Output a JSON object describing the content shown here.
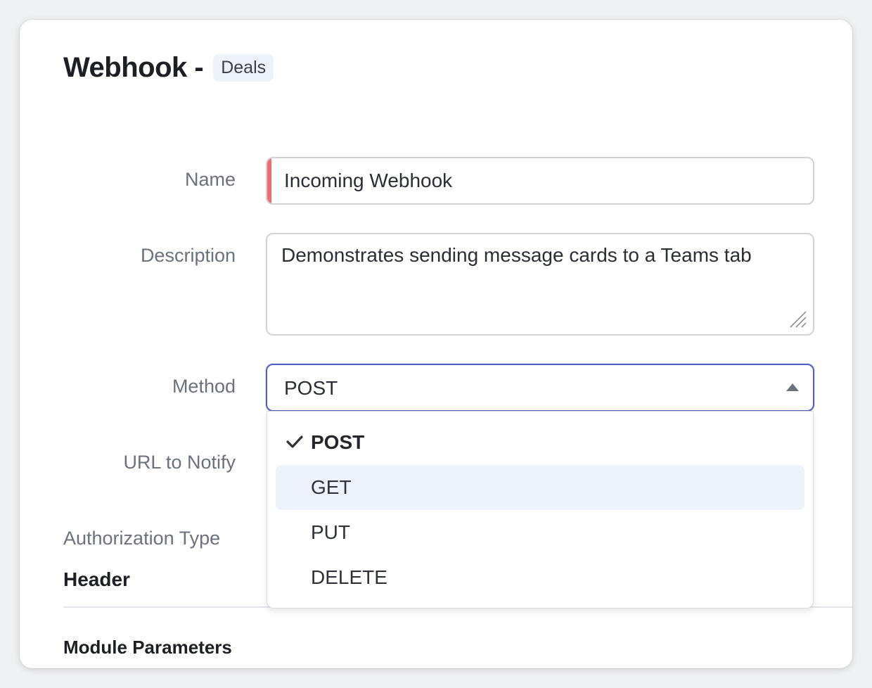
{
  "header": {
    "title": "Webhook -",
    "module": "Deals"
  },
  "form": {
    "name": {
      "label": "Name",
      "value": "Incoming Webhook"
    },
    "description": {
      "label": "Description",
      "value": "Demonstrates sending message cards to a Teams tab"
    },
    "method": {
      "label": "Method",
      "value": "POST",
      "options": [
        "POST",
        "GET",
        "PUT",
        "DELETE"
      ],
      "selected_index": 0,
      "hovered_index": 1
    },
    "url": {
      "label": "URL to Notify"
    },
    "auth": {
      "label": "Authorization Type"
    }
  },
  "sections": {
    "header": "Header",
    "module_parameters": "Module Parameters"
  },
  "colors": {
    "required_marker": "#f16c6c",
    "focus_border": "#4f5fbf",
    "hover_bg": "#eef2fc",
    "badge_bg": "#eef2fb"
  },
  "icons": {
    "check": "check-icon",
    "caret": "caret-up-icon",
    "resize": "resize-handle-icon"
  }
}
